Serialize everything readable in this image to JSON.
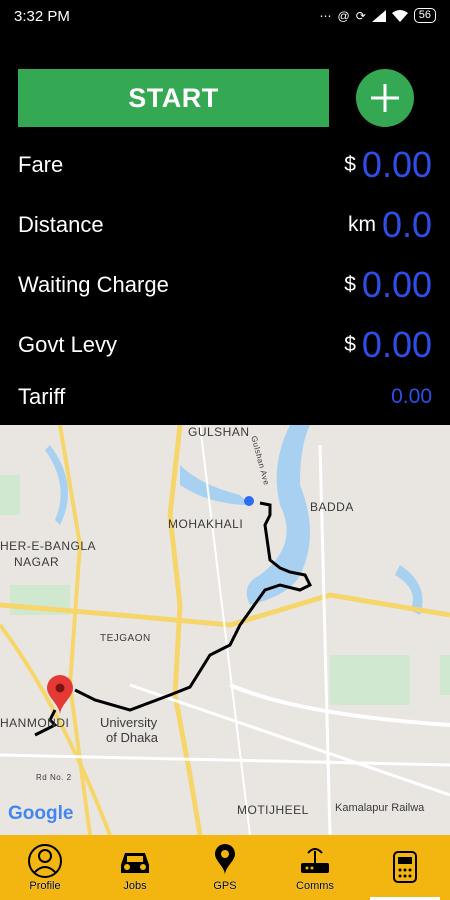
{
  "status_bar": {
    "time": "3:32  PM",
    "battery": "56"
  },
  "actions": {
    "start_label": "START"
  },
  "meter": {
    "fare": {
      "label": "Fare",
      "unit": "$",
      "value": "0.00"
    },
    "distance": {
      "label": "Distance",
      "unit": "km",
      "value": "0.0"
    },
    "waiting": {
      "label": "Waiting Charge",
      "unit": "$",
      "value": "0.00"
    },
    "levy": {
      "label": "Govt Levy",
      "unit": "$",
      "value": "0.00"
    },
    "tariff": {
      "label": "Tariff",
      "value": "0.00"
    }
  },
  "map": {
    "labels": {
      "gulshan": "GULSHAN",
      "badda": "BADDA",
      "mohakhali": "MOHAKHALI",
      "sher_e_bangla": "HER-E-BANGLA",
      "nagar": "NAGAR",
      "tejgaon": "TEJGAON",
      "dhanmondi": "HANMONDI",
      "university1": "University",
      "university2": "of Dhaka",
      "motijheel": "MOTIJHEEL",
      "kamalapur": "Kamalapur Railwa",
      "gulshan_ave": "Gulshan Ave",
      "rd2": "Rd No. 2"
    },
    "attribution": "Google"
  },
  "bottom_nav": [
    {
      "label": "Profile",
      "icon": "profile-icon"
    },
    {
      "label": "Jobs",
      "icon": "car-icon"
    },
    {
      "label": "GPS",
      "icon": "location-pin-icon"
    },
    {
      "label": "Comms",
      "icon": "router-icon"
    },
    {
      "label": "",
      "icon": "taxi-meter-icon"
    }
  ],
  "colors": {
    "start_green": "#34a853",
    "value_blue": "#2d4ee8",
    "nav_yellow": "#f3b510"
  }
}
